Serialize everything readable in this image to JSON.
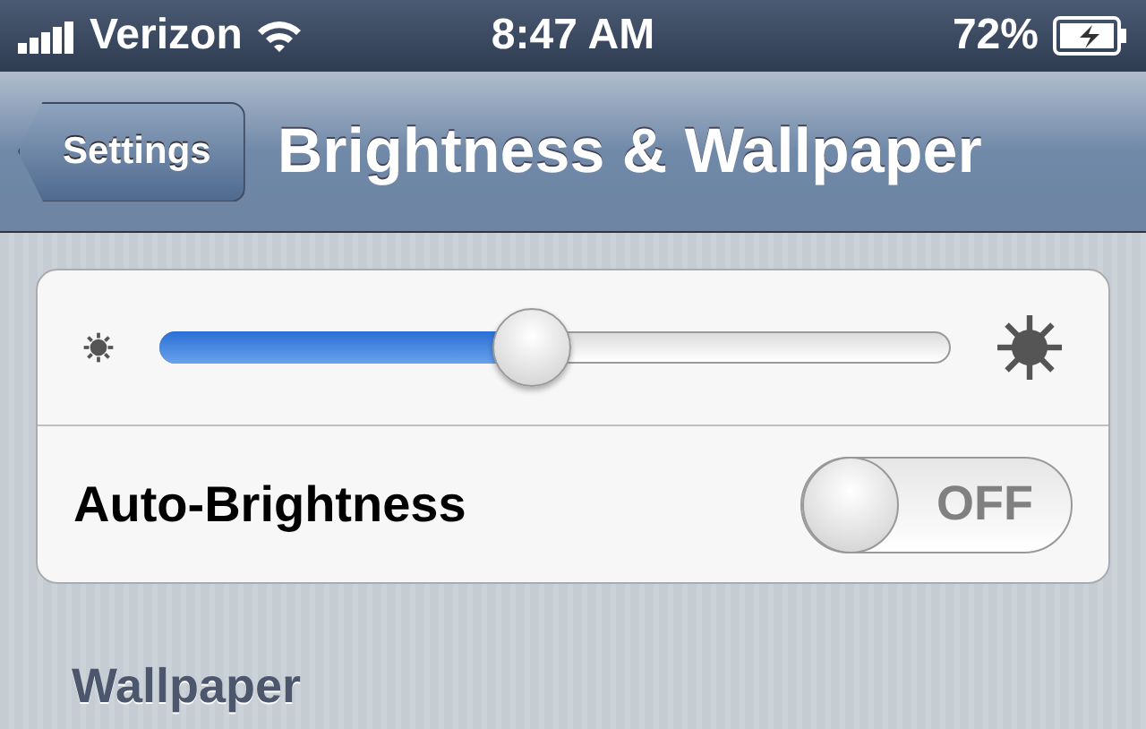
{
  "status_bar": {
    "carrier": "Verizon",
    "time": "8:47 AM",
    "battery": "72%"
  },
  "nav_bar": {
    "back": "Settings",
    "title": "Brightness & Wallpaper"
  },
  "brightness": {
    "level": 0.47
  },
  "auto_brightness": {
    "label": "Auto-Brightness",
    "on": false,
    "state_text": "OFF"
  },
  "section": {
    "title": "Wallpaper"
  }
}
